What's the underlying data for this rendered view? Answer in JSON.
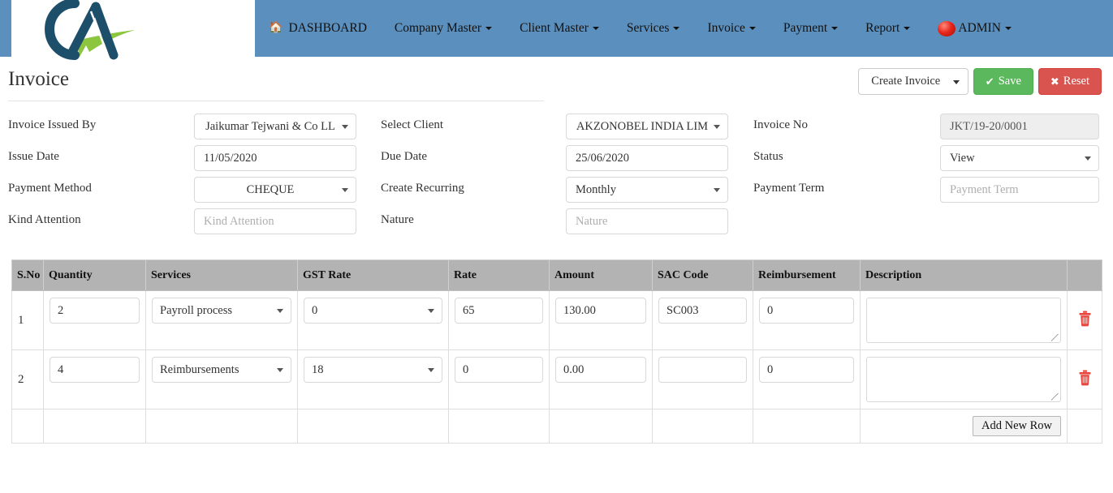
{
  "brand": {
    "logo_text": "CA",
    "logo_alt": "ca-monogram-logo"
  },
  "colors": {
    "navbar_bg": "#5b8fbd",
    "save_green": "#5cb85c",
    "reset_red": "#d9534f",
    "table_header_gray": "#b3b3b3",
    "trash_red": "#e8453c",
    "logo_navy": "#1d4e6a",
    "logo_green": "#8cc63f"
  },
  "navbar": {
    "items": [
      {
        "label": "DASHBOARD",
        "icon": "home-icon",
        "caret": false
      },
      {
        "label": "Company Master",
        "icon": null,
        "caret": true
      },
      {
        "label": "Client Master",
        "icon": null,
        "caret": true
      },
      {
        "label": "Services",
        "icon": null,
        "caret": true
      },
      {
        "label": "Invoice",
        "icon": null,
        "caret": true
      },
      {
        "label": "Payment",
        "icon": null,
        "caret": true
      },
      {
        "label": "Report",
        "icon": null,
        "caret": true
      },
      {
        "label": "ADMIN",
        "icon": "user-avatar-icon",
        "caret": true
      }
    ]
  },
  "page": {
    "title": "Invoice"
  },
  "toolbar": {
    "create_invoice_label": "Create Invoice",
    "save_label": "Save",
    "save_glyph": "✔",
    "reset_label": "Reset",
    "reset_glyph": "✖"
  },
  "form": {
    "col1": [
      {
        "label": "Invoice Issued By",
        "type": "select",
        "value": "Jaikumar Tejwani & Co LL"
      },
      {
        "label": "Issue Date",
        "type": "text",
        "value": "11/05/2020"
      },
      {
        "label": "Payment Method",
        "type": "select",
        "value": "CHEQUE"
      },
      {
        "label": "Kind Attention",
        "type": "text",
        "value": "",
        "placeholder": "Kind Attention"
      }
    ],
    "col2": [
      {
        "label": "Select Client",
        "type": "select",
        "value": "AKZONOBEL INDIA LIM"
      },
      {
        "label": "Due Date",
        "type": "text",
        "value": "25/06/2020"
      },
      {
        "label": "Create Recurring",
        "type": "select",
        "value": "Monthly"
      },
      {
        "label": "Nature",
        "type": "text",
        "value": "",
        "placeholder": "Nature"
      }
    ],
    "col3": [
      {
        "label": "Invoice No",
        "type": "readonly",
        "value": "JKT/19-20/0001"
      },
      {
        "label": "Status",
        "type": "select",
        "value": "View"
      },
      {
        "label": "Payment Term",
        "type": "text",
        "value": "",
        "placeholder": "Payment Term"
      }
    ]
  },
  "items_table": {
    "columns": [
      "S.No",
      "Quantity",
      "Services",
      "GST Rate",
      "Rate",
      "Amount",
      "SAC Code",
      "Reimbursement",
      "Description",
      ""
    ],
    "rows": [
      {
        "sno": "1",
        "quantity": "2",
        "services": "Payroll process",
        "gst_rate": "0",
        "rate": "65",
        "amount": "130.00",
        "sac_code": "SC003",
        "reimbursement": "0",
        "description": "",
        "delete_icon": "trash-icon"
      },
      {
        "sno": "2",
        "quantity": "4",
        "services": "Reimbursements",
        "gst_rate": "18",
        "rate": "0",
        "amount": "0.00",
        "sac_code": "",
        "reimbursement": "0",
        "description": "",
        "delete_icon": "trash-icon"
      }
    ],
    "add_row_label": "Add New Row"
  }
}
